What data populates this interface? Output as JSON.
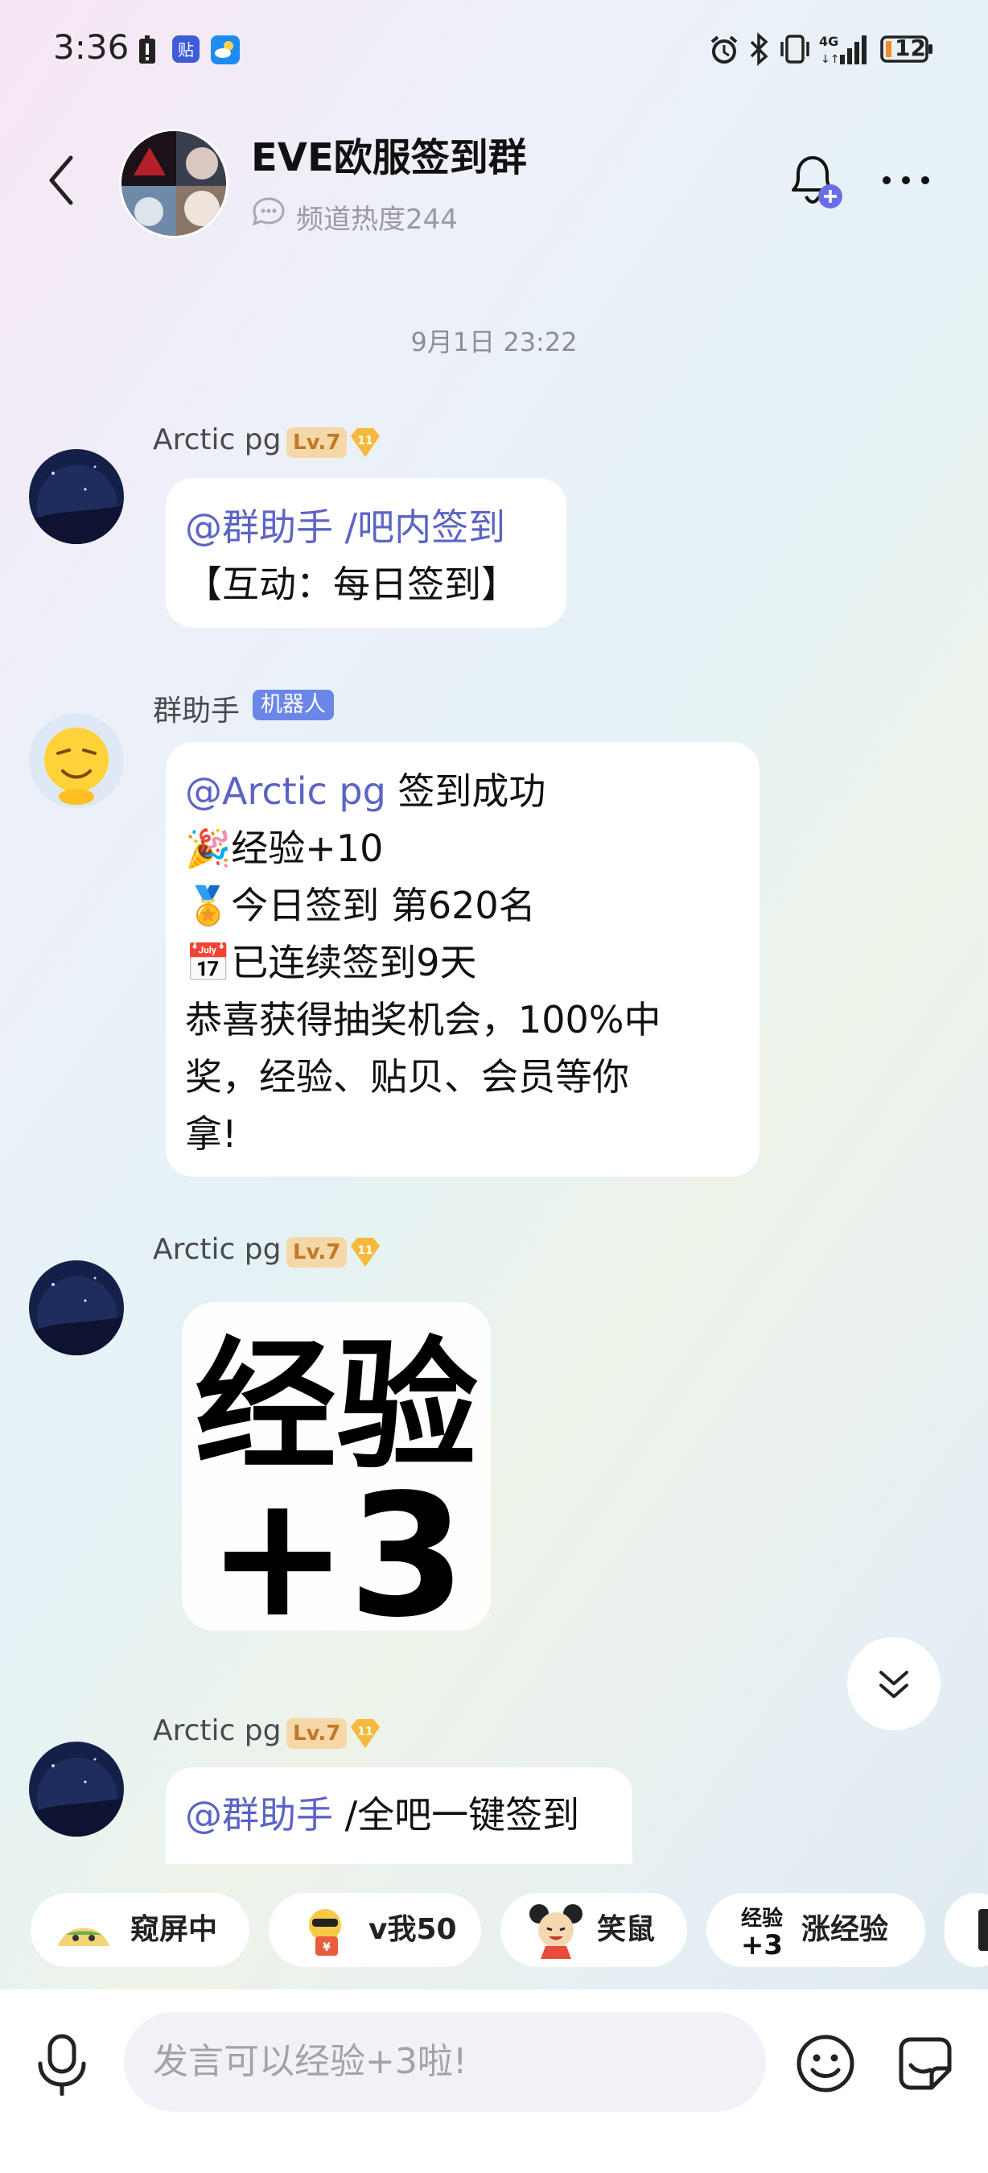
{
  "status_bar": {
    "time": "3:36",
    "battery": "12",
    "network": "4G"
  },
  "header": {
    "title": "EVE欧服签到群",
    "heat": "频道热度244"
  },
  "chat": {
    "timestamp": "9月1日 23:22",
    "messages": [
      {
        "sender": "Arctic pg",
        "level": "Lv.7",
        "badge": "11",
        "mention": "@群助手",
        "text": "/吧内签到",
        "line2": "【互动：每日签到】"
      },
      {
        "sender": "群助手",
        "tag": "机器人",
        "mention": "@Arctic pg",
        "text": "签到成功",
        "lines": [
          "🎉经验+10",
          "🏅今日签到 第620名",
          "📅已连续签到9天",
          "恭喜获得抽奖机会，100%中",
          "奖，经验、贴贝、会员等你",
          "拿!"
        ]
      },
      {
        "sender": "Arctic pg",
        "level": "Lv.7",
        "badge": "11",
        "sticker": "经验+3"
      },
      {
        "sender": "Arctic pg",
        "level": "Lv.7",
        "badge": "11",
        "mention": "@群助手",
        "text": "/全吧一键签到"
      }
    ]
  },
  "quick_chips": [
    {
      "label": "窥屏中",
      "icon": "peek-icon"
    },
    {
      "label": "v我50",
      "icon": "v50-icon"
    },
    {
      "label": "笑鼠",
      "icon": "laughing-mouse-icon"
    },
    {
      "label": "涨经验",
      "icon": "exp-plus3-icon"
    }
  ],
  "input": {
    "placeholder": "发言可以经验+3啦!"
  },
  "colors": {
    "mention": "#5b64c6",
    "level_bg": "#f6d8a8",
    "robot_tag": "#6a86e8"
  }
}
